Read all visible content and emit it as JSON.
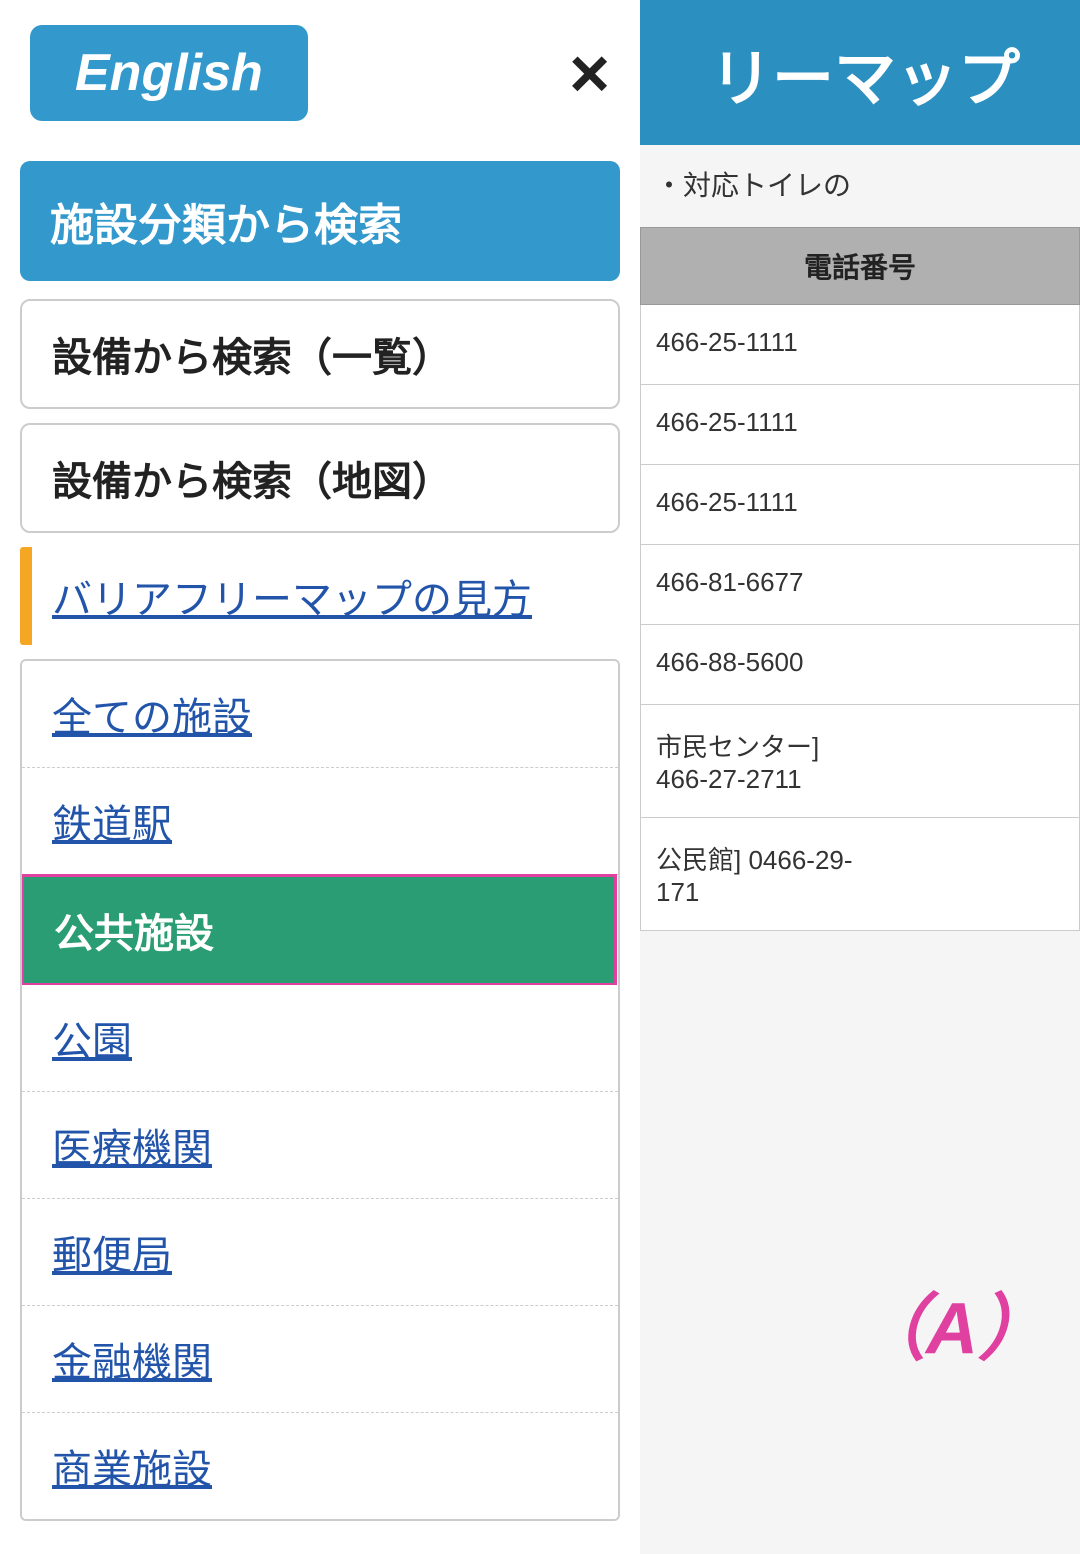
{
  "header": {
    "title": "リーマップ",
    "background_color": "#2b8fc0"
  },
  "right_panel": {
    "description": "・対応トイレの",
    "table_header": "電話番号",
    "phone_numbers": [
      "466-25-1111",
      "466-25-1111",
      "466-25-1111",
      "466-81-6677",
      "466-88-5600",
      "市民センター]\n466-27-2711",
      "公民館] 0466-29-\n171"
    ]
  },
  "menu": {
    "english_button_label": "English",
    "close_button_label": "×",
    "search_by_category_label": "施設分類から検索",
    "search_by_equipment_list_label": "設備から検索（一覧）",
    "search_by_equipment_map_label": "設備から検索（地図）",
    "map_guide_link_label": "バリアフリーマップの見方",
    "sublist_items": [
      {
        "label": "全ての施設",
        "id": "all-facilities",
        "active": false
      },
      {
        "label": "鉄道駅",
        "id": "train-stations",
        "active": false
      },
      {
        "label": "公共施設",
        "id": "public-facilities",
        "active": true
      },
      {
        "label": "公園",
        "id": "parks",
        "active": false
      },
      {
        "label": "医療機関",
        "id": "medical",
        "active": false
      },
      {
        "label": "郵便局",
        "id": "post-offices",
        "active": false
      },
      {
        "label": "金融機関",
        "id": "financial",
        "active": false
      },
      {
        "label": "商業施設",
        "id": "commercial",
        "active": false
      }
    ],
    "badge_label": "（A）"
  }
}
